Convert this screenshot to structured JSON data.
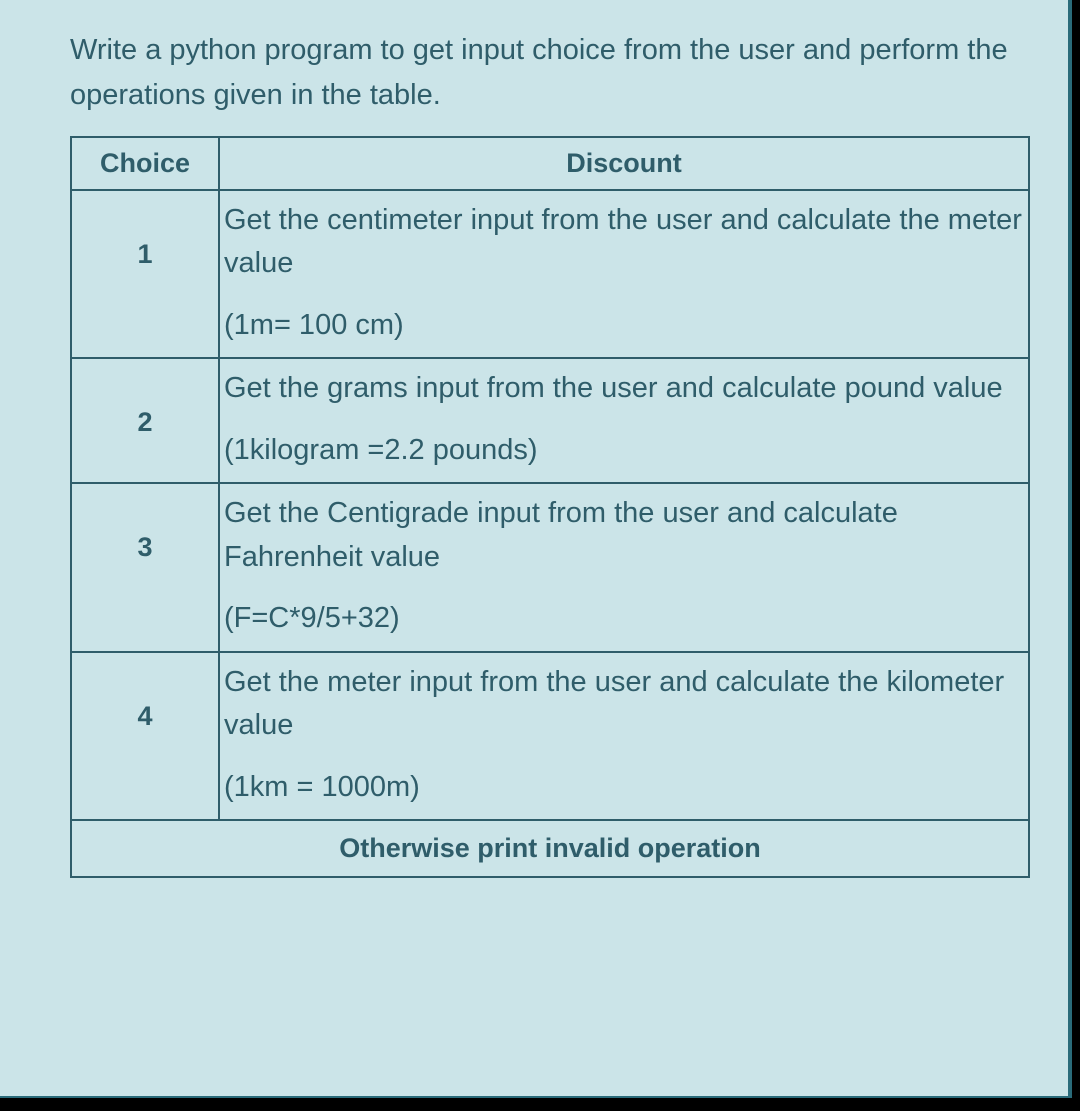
{
  "intro": "Write a python program to get input choice from the user and perform the operations given in the table.",
  "headers": {
    "choice": "Choice",
    "discount": "Discount"
  },
  "rows": [
    {
      "choice": "1",
      "description": "Get the centimeter input from the user and calculate the meter value",
      "formula": "(1m= 100 cm)"
    },
    {
      "choice": "2",
      "description": "Get the grams input from the user and calculate pound value",
      "formula": "(1kilogram =2.2 pounds)"
    },
    {
      "choice": "3",
      "description": "Get the Centigrade input from the user and calculate Fahrenheit value",
      "formula": "(F=C*9/5+32)"
    },
    {
      "choice": "4",
      "description": "Get the meter input from the user and calculate the kilometer value",
      "formula": "(1km = 1000m)"
    }
  ],
  "footer": "Otherwise print invalid operation"
}
